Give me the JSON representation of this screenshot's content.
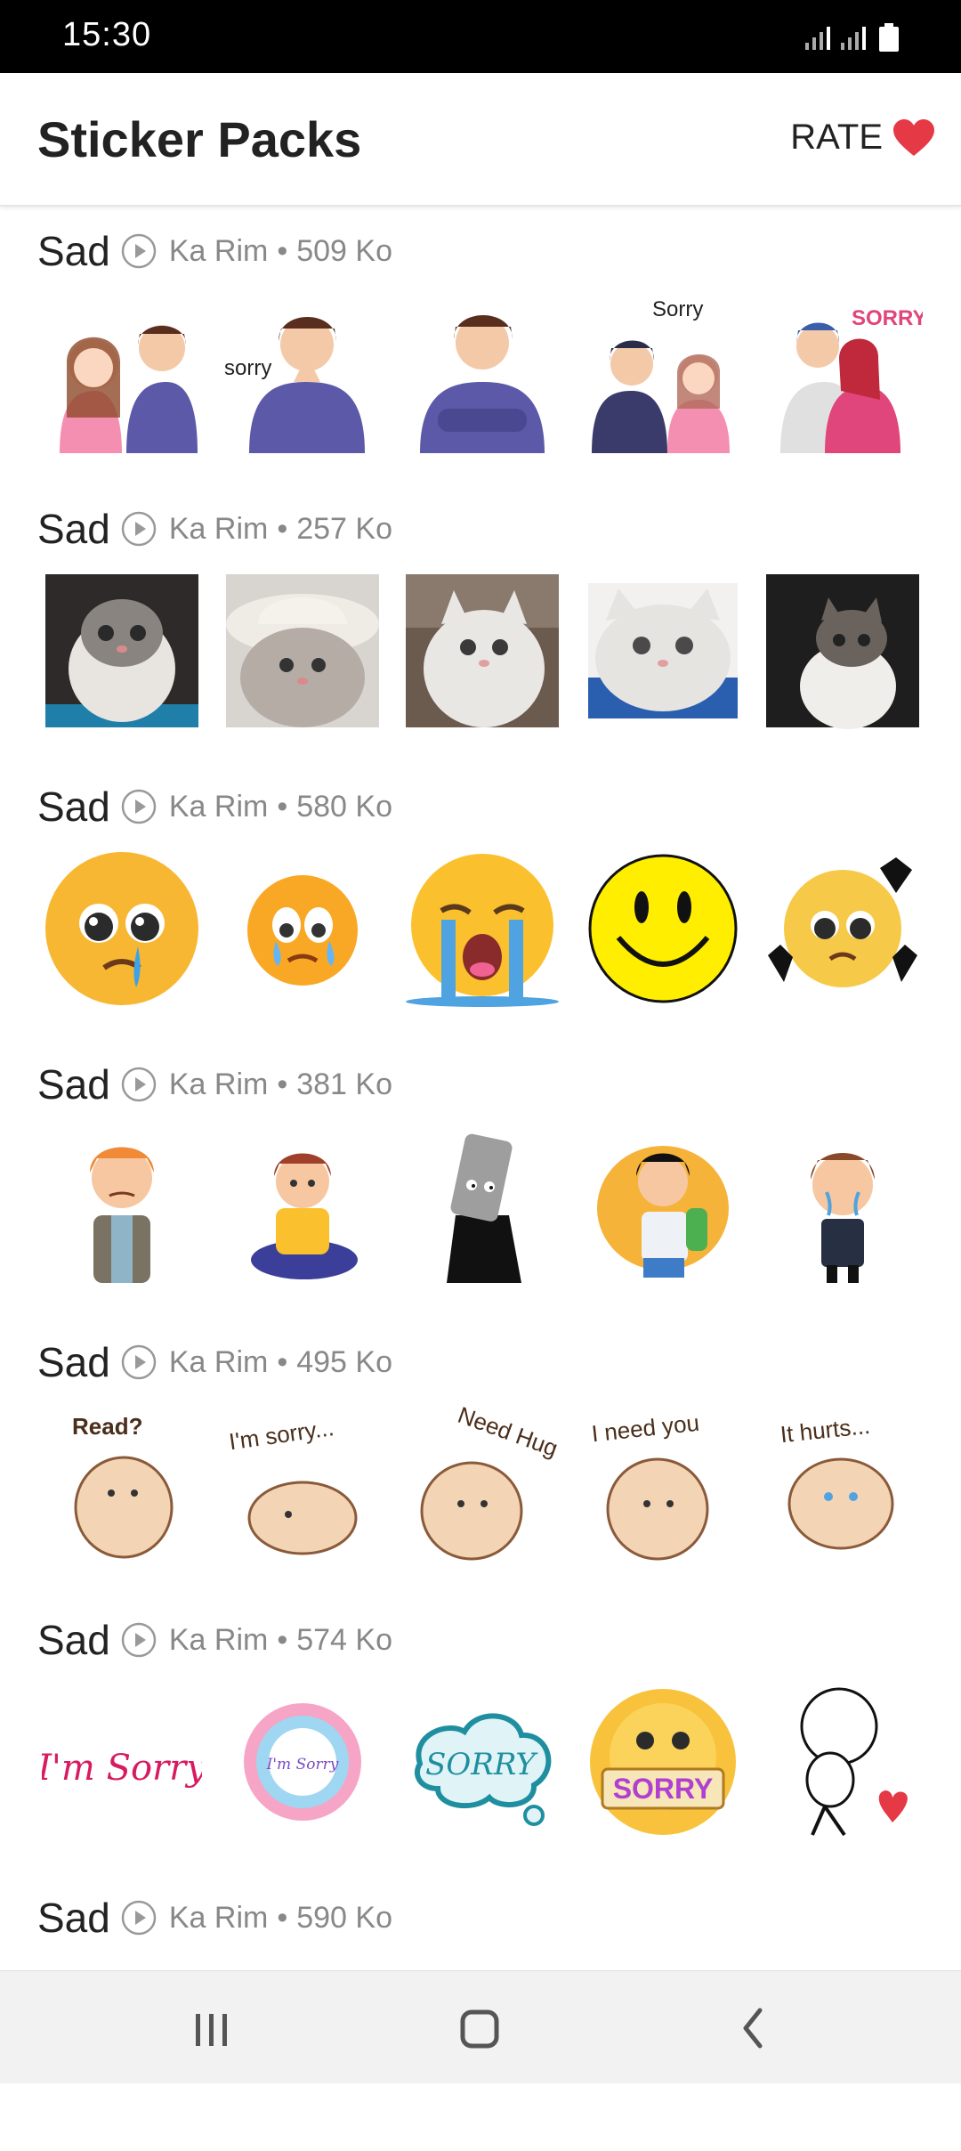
{
  "status_bar": {
    "time": "15:30"
  },
  "app_bar": {
    "title": "Sticker Packs",
    "rate_label": "RATE"
  },
  "packs": [
    {
      "name": "Sad",
      "author": "Ka Rim",
      "size": "509 Ko",
      "sticker_texts": [
        "",
        "sorry",
        "",
        "Sorry",
        "SORRY"
      ]
    },
    {
      "name": "Sad",
      "author": "Ka Rim",
      "size": "257 Ko"
    },
    {
      "name": "Sad",
      "author": "Ka Rim",
      "size": "580 Ko"
    },
    {
      "name": "Sad",
      "author": "Ka Rim",
      "size": "381 Ko"
    },
    {
      "name": "Sad",
      "author": "Ka Rim",
      "size": "495 Ko",
      "sticker_texts": [
        "Read?",
        "I'm sorry...",
        "Need Hug",
        "I need you",
        "It hurts..."
      ]
    },
    {
      "name": "Sad",
      "author": "Ka Rim",
      "size": "574 Ko",
      "sticker_texts": [
        "I'm Sorry",
        "I'm Sorry",
        "SORRY",
        "SORRY",
        ""
      ]
    },
    {
      "name": "Sad",
      "author": "Ka Rim",
      "size": "590 Ko"
    }
  ],
  "meta_separator": "•",
  "colors": {
    "status_bar_bg": "#000000",
    "heart": "#e53946",
    "meta_text": "#888888"
  }
}
